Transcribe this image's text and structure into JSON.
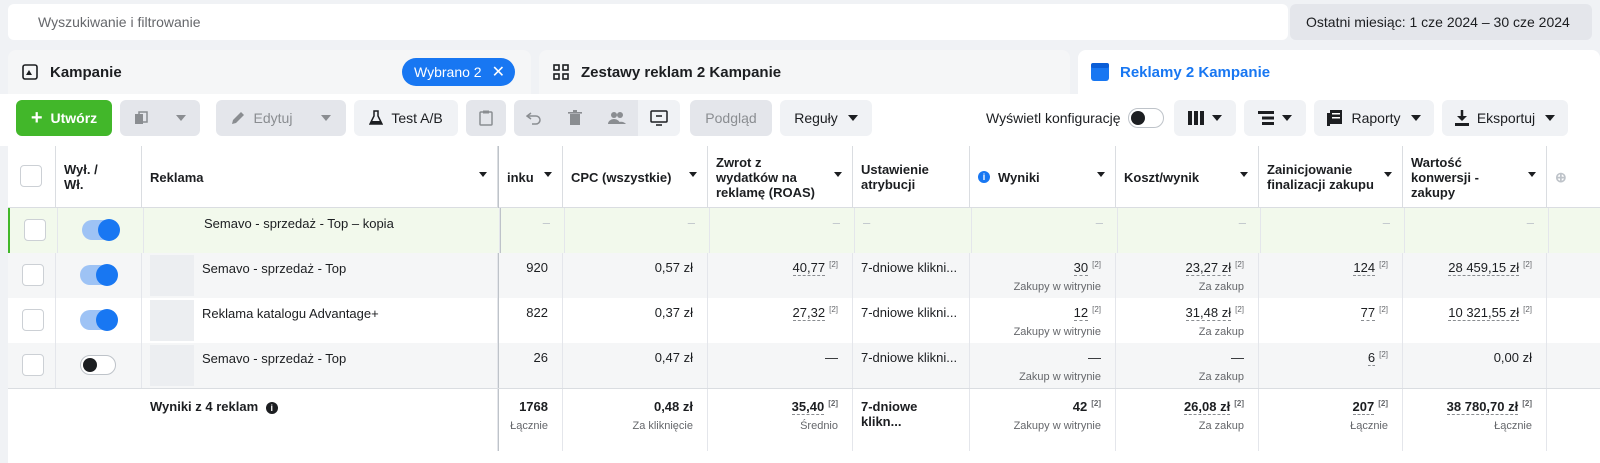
{
  "search": {
    "placeholder": "Wyszukiwanie i filtrowanie"
  },
  "date_range": "Ostatni miesiąc: 1 cze 2024 – 30 cze 2024",
  "tabs": {
    "campaigns": {
      "label": "Kampanie",
      "chip": "Wybrano 2"
    },
    "adsets": {
      "label": "Zestawy reklam 2 Kampanie"
    },
    "ads": {
      "label": "Reklamy 2 Kampanie"
    }
  },
  "toolbar": {
    "create": "Utwórz",
    "edit": "Edytuj",
    "ab_test": "Test A/B",
    "preview": "Podgląd",
    "rules": "Reguły",
    "show_config": "Wyświetl konfigurację",
    "reports": "Raporty",
    "export": "Eksportuj"
  },
  "columns": {
    "onoff": "Wył. / Wł.",
    "ad": "Reklama",
    "clicks": "inku",
    "cpc": "CPC (wszystkie)",
    "roas": "Zwrot z wydatków na reklamę (ROAS)",
    "attribution": "Ustawienie atrybucji",
    "results": "Wyniki",
    "cost_per_result": "Koszt/wynik",
    "checkout": "Zainicjowanie finalizacji zakupu",
    "conv_value": "Wartość konwersji - zakupy"
  },
  "rows": [
    {
      "name": "Semavo - sprzedaż - Top – kopia",
      "clicks": "–",
      "cpc": "–",
      "roas": "–",
      "attribution": "–",
      "results": "–",
      "results_sub": "",
      "cost": "–",
      "cost_sub": "",
      "checkout": "–",
      "value": "–"
    },
    {
      "name": "Semavo - sprzedaż - Top",
      "clicks": "920",
      "cpc": "0,57 zł",
      "roas": "40,77",
      "attribution": "7-dniowe klikni...",
      "results": "30",
      "results_sub": "Zakupy w witrynie",
      "cost": "23,27 zł",
      "cost_sub": "Za zakup",
      "checkout": "124",
      "value": "28 459,15 zł"
    },
    {
      "name": "Reklama katalogu Advantage+",
      "clicks": "822",
      "cpc": "0,37 zł",
      "roas": "27,32",
      "attribution": "7-dniowe klikni...",
      "results": "12",
      "results_sub": "Zakupy w witrynie",
      "cost": "31,48 zł",
      "cost_sub": "Za zakup",
      "checkout": "77",
      "value": "10 321,55 zł"
    },
    {
      "name": "Semavo - sprzedaż - Top",
      "clicks": "26",
      "cpc": "0,47 zł",
      "roas": "—",
      "attribution": "7-dniowe klikni...",
      "results": "—",
      "results_sub": "Zakup w witrynie",
      "cost": "—",
      "cost_sub": "Za zakup",
      "checkout": "6",
      "value": "0,00 zł"
    }
  ],
  "sup": "[2]",
  "totals": {
    "label": "Wyniki z 4 reklam",
    "clicks": "1768",
    "clicks_sub": "Łącznie",
    "cpc": "0,48 zł",
    "cpc_sub": "Za kliknięcie",
    "roas": "35,40",
    "roas_sub": "Średnio",
    "attribution": "7-dniowe klikn...",
    "results": "42",
    "results_sub": "Zakupy w witrynie",
    "cost": "26,08 zł",
    "cost_sub": "Za zakup",
    "checkout": "207",
    "checkout_sub": "Łącznie",
    "value": "38 780,70 zł",
    "value_sub": "Łącznie"
  }
}
